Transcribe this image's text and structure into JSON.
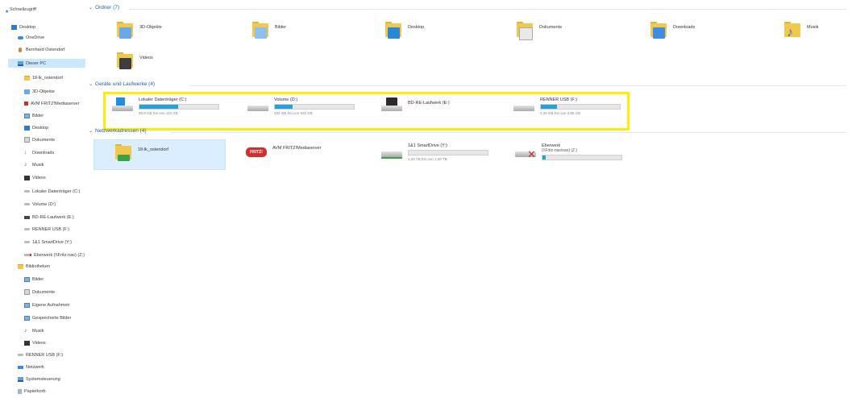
{
  "sidebar": {
    "items": [
      {
        "label": "Schnellzugriff",
        "icon": "star-icon"
      },
      {
        "label": "Desktop",
        "icon": "desktop-icon"
      },
      {
        "label": "OneDrive",
        "icon": "cloud-icon"
      },
      {
        "label": "Bernhard Ostendorf",
        "icon": "user-icon"
      },
      {
        "label": "Dieser PC",
        "icon": "computer-icon"
      },
      {
        "label": "18-lk_ostendorf",
        "icon": "folder-icon"
      },
      {
        "label": "3D-Objekte",
        "icon": "3d-objects-icon"
      },
      {
        "label": "AVM FRITZ!Mediaserver",
        "icon": "media-server-icon"
      },
      {
        "label": "Bilder",
        "icon": "pictures-icon"
      },
      {
        "label": "Desktop",
        "icon": "desktop-icon"
      },
      {
        "label": "Dokumente",
        "icon": "documents-icon"
      },
      {
        "label": "Downloads",
        "icon": "downloads-icon"
      },
      {
        "label": "Musik",
        "icon": "music-icon"
      },
      {
        "label": "Videos",
        "icon": "videos-icon"
      },
      {
        "label": "Lokaler Datenträger (C:)",
        "icon": "windows-drive-icon"
      },
      {
        "label": "Volume (D:)",
        "icon": "drive-icon"
      },
      {
        "label": "BD-RE-Laufwerk (E:)",
        "icon": "dvd-drive-icon"
      },
      {
        "label": "RENNER USB (F:)",
        "icon": "usb-drive-icon"
      },
      {
        "label": "1&1 SmartDrive (Y:)",
        "icon": "network-drive-icon"
      },
      {
        "label": "Eberwerk (\\\\Fritz-nas) (Z:)",
        "icon": "disconnected-drive-icon"
      },
      {
        "label": "Bibliotheken",
        "icon": "libraries-icon"
      },
      {
        "label": "Bilder",
        "icon": "pictures-icon"
      },
      {
        "label": "Dokumente",
        "icon": "documents-icon"
      },
      {
        "label": "Eigene Aufnahmen",
        "icon": "recordings-icon"
      },
      {
        "label": "Gespeicherte Bilder",
        "icon": "saved-pictures-icon"
      },
      {
        "label": "Musik",
        "icon": "music-icon"
      },
      {
        "label": "Videos",
        "icon": "videos-icon"
      },
      {
        "label": "RENNER USB (F:)",
        "icon": "usb-drive-icon"
      },
      {
        "label": "Netzwerk",
        "icon": "network-icon"
      },
      {
        "label": "Systemsteuerung",
        "icon": "control-panel-icon"
      },
      {
        "label": "Papierkorb",
        "icon": "recycle-bin-icon"
      }
    ]
  },
  "groups": {
    "folders": "Ordner (7)",
    "drives": "Geräte und Laufwerke (4)",
    "network": "Netzwerkadressen (4)"
  },
  "folders": [
    {
      "label": "3D-Objekte",
      "icon": "3d-objects-folder-icon"
    },
    {
      "label": "Bilder",
      "icon": "pictures-folder-icon"
    },
    {
      "label": "Desktop",
      "icon": "desktop-folder-icon"
    },
    {
      "label": "Dokumente",
      "icon": "documents-folder-icon"
    },
    {
      "label": "Downloads",
      "icon": "downloads-folder-icon"
    },
    {
      "label": "Musik",
      "icon": "music-folder-icon"
    },
    {
      "label": "Videos",
      "icon": "videos-folder-icon"
    }
  ],
  "drives": [
    {
      "name": "Lokaler Datenträger (C:)",
      "free": "55,8 GB frei von 110 GB",
      "usage": 0.49,
      "icon": "windows-drive-icon"
    },
    {
      "name": "Volume (D:)",
      "free": "333 GB frei von 931 GB",
      "usage": 0.22,
      "icon": "drive-icon"
    },
    {
      "name": "BD-RE-Laufwerk (E:)",
      "icon": "dvd-drive-icon"
    },
    {
      "name": "RENNER USB (F:)",
      "free": "2,39 GB frei von 3,86 GB",
      "usage": 0.2,
      "icon": "usb-drive-icon"
    }
  ],
  "network": [
    {
      "name": "18-lk_ostendorf",
      "icon": "samba-share-icon"
    },
    {
      "name": "AVM FRITZ!Mediaserver",
      "icon": "fritz-mediaserver-icon"
    },
    {
      "name": "1&1 SmartDrive (Y:)",
      "free": "1,00 TB frei von 1,00 TB",
      "usage": 0.0,
      "icon": "network-drive-icon"
    },
    {
      "name": "Eberwerk",
      "sub": "(\\\\Fritz-nas\\nas) (Z:)",
      "usage": 0.04,
      "icon": "disconnected-drive-icon"
    }
  ],
  "colors": {
    "highlight": "#ffee00",
    "usage_bar": "#26a0da",
    "selection": "#cce8ff",
    "group_header": "#1f5fa8"
  }
}
